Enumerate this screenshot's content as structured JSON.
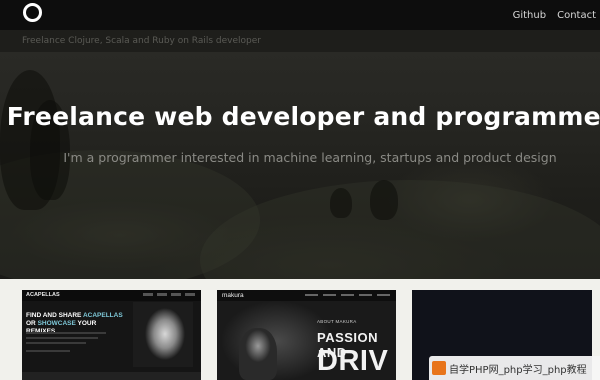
{
  "nav": {
    "links": [
      {
        "label": "Github"
      },
      {
        "label": "Contact"
      }
    ]
  },
  "hero": {
    "tagline": "Freelance Clojure, Scala and Ruby on Rails developer",
    "headline": "Freelance web developer and programmer",
    "subhead": "I'm a programmer interested in machine learning, startups and product design"
  },
  "portfolio": {
    "items": [
      {
        "brand": "ACAPELLAS",
        "headline_1": "FIND AND SHARE ",
        "headline_1_accent": "ACAPELLAS",
        "headline_2": "OR ",
        "headline_2_accent": "SHOWCASE",
        "headline_2_rest": " YOUR REMIXES"
      },
      {
        "brand": "makura",
        "small": "ABOUT MAKURA",
        "big_1": "PASSION AND",
        "big_2": "DRIV"
      },
      {}
    ]
  },
  "watermark": {
    "text": "自学PHP网_php学习_php教程"
  },
  "colors": {
    "topbar": "#0d0d0d",
    "hero_text": "#ffffff",
    "subhead_text": "#8a8a85",
    "page_bg": "#f2f2ee"
  }
}
